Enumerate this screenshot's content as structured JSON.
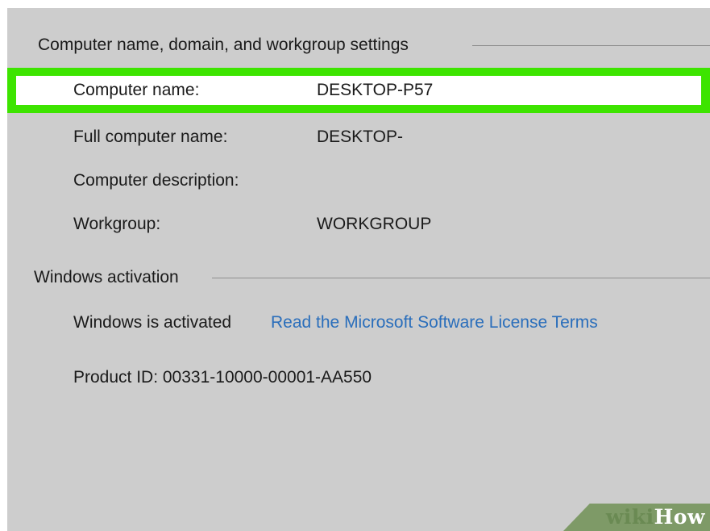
{
  "computer_settings": {
    "title": "Computer name, domain, and workgroup settings",
    "rows": [
      {
        "label": "Computer name:",
        "value": "DESKTOP-P57"
      },
      {
        "label": "Full computer name:",
        "value": "DESKTOP-"
      },
      {
        "label": "Computer description:",
        "value": ""
      },
      {
        "label": "Workgroup:",
        "value": "WORKGROUP"
      }
    ]
  },
  "activation": {
    "title": "Windows activation",
    "status": "Windows is activated",
    "license_link": "Read the Microsoft Software License Terms",
    "product_id": "Product ID: 00331-10000-00001-AA550"
  },
  "watermark": {
    "wiki": "wiki",
    "how": "How"
  },
  "colors": {
    "panel_background": "#cdcdcd",
    "highlight": "#3de400",
    "link": "#2a6ebb",
    "watermark_band": "#7e9a67"
  }
}
